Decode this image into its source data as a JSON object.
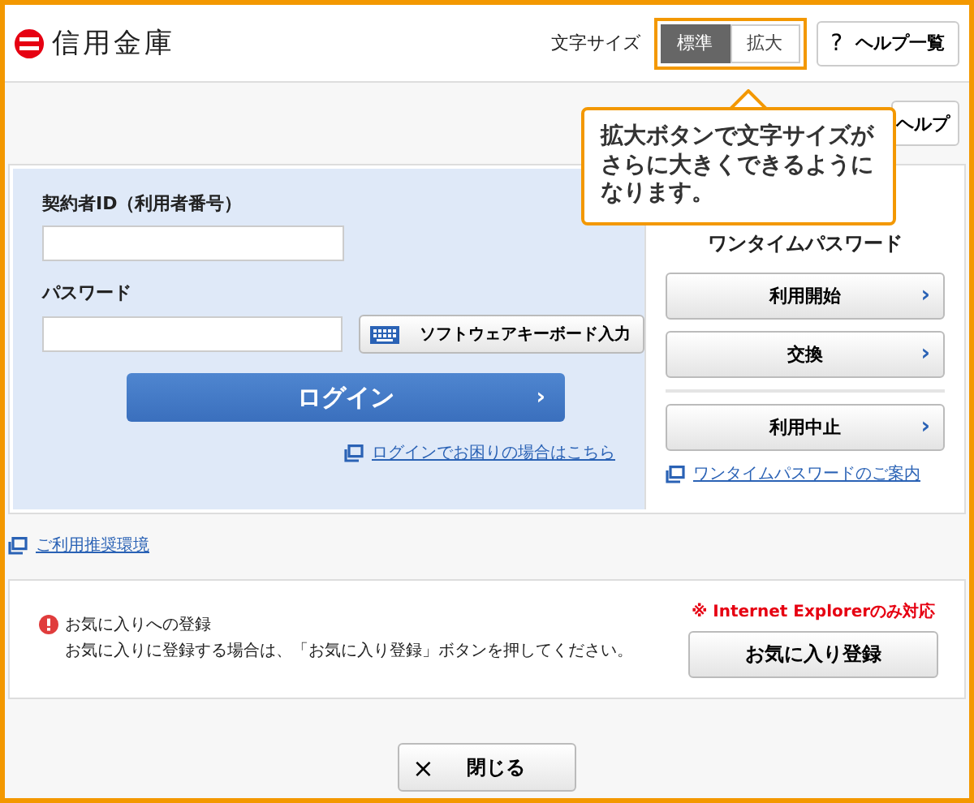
{
  "header": {
    "logo_text": "信用金庫",
    "font_size": {
      "label": "文字サイズ",
      "options": [
        {
          "label": "標準",
          "selected": true
        },
        {
          "label": "拡大",
          "selected": false
        }
      ]
    },
    "help_button": {
      "icon_text": "?",
      "label": "ヘルプ一覧"
    }
  },
  "help_button": "ヘルプ",
  "callout": "拡大ボタンで文字サイズがさらに大きくできるようになります。",
  "login": {
    "id_label": "契約者ID（利用者番号）",
    "password_label": "パスワード",
    "keyboard_button": "ソフトウェアキーボード入力",
    "login_button": "ログイン",
    "chevron": "›",
    "trouble_link": "ログインでお困りの場合はこちら"
  },
  "one_time_password": {
    "title": "ワンタイムパスワード",
    "button_groups": [
      [
        "利用開始",
        "交換"
      ],
      [
        "利用中止"
      ]
    ],
    "chevron": "›",
    "guide_link": "ワンタイムパスワードのご案内"
  },
  "environment_link": "ご利用推奨環境",
  "favorites": {
    "title": "お気に入りへの登録",
    "description": "お気に入りに登録する場合は、「お気に入り登録」ボタンを押してください。",
    "note": "※ Internet Explorerのみ対応",
    "button": "お気に入り登録"
  },
  "close_button": {
    "icon_text": "×",
    "label": "閉じる"
  }
}
